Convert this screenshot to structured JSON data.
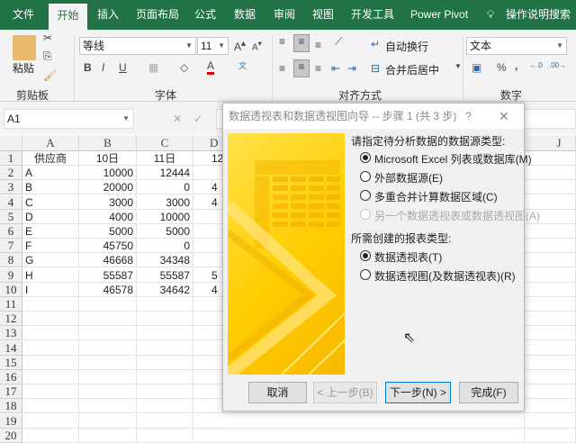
{
  "tabs": [
    "文件",
    "开始",
    "插入",
    "页面布局",
    "公式",
    "数据",
    "审阅",
    "视图",
    "开发工具",
    "Power Pivot",
    "操作说明搜索"
  ],
  "ribbon": {
    "clipboard": {
      "label": "剪贴板",
      "paste": "粘贴"
    },
    "font": {
      "label": "字体",
      "name": "等线",
      "size": "11",
      "bold": "B",
      "italic": "I",
      "underline": "U",
      "color": "#e00000"
    },
    "align": {
      "label": "对齐方式",
      "wrap": "自动换行",
      "merge": "合并后居中"
    },
    "number": {
      "label": "数字",
      "format": "文本",
      "percent": "%",
      "comma": ","
    }
  },
  "namebox": "A1",
  "columns": [
    "A",
    "B",
    "C",
    "D",
    "J"
  ],
  "rows": [
    "1",
    "2",
    "3",
    "4",
    "5",
    "6",
    "7",
    "8",
    "9",
    "10",
    "11",
    "12",
    "13",
    "14",
    "15",
    "16",
    "17",
    "18",
    "19",
    "20"
  ],
  "table": [
    [
      "供应商",
      "10日",
      "11日",
      "12"
    ],
    [
      "A",
      "10000",
      "12444",
      ""
    ],
    [
      "B",
      "20000",
      "0",
      "4"
    ],
    [
      "C",
      "3000",
      "3000",
      "4"
    ],
    [
      "D",
      "4000",
      "10000",
      ""
    ],
    [
      "E",
      "5000",
      "5000",
      ""
    ],
    [
      "F",
      "45750",
      "0",
      ""
    ],
    [
      "G",
      "46668",
      "34348",
      ""
    ],
    [
      "H",
      "55587",
      "55587",
      "5"
    ],
    [
      "I",
      "46578",
      "34642",
      "4"
    ]
  ],
  "dialog": {
    "title": "数据透视表和数据透视图向导 -- 步骤 1 (共 3 步)",
    "help": "?",
    "close": "✕",
    "source_heading": "请指定待分析数据的数据源类型:",
    "source_options": [
      "Microsoft Excel 列表或数据库(M)",
      "外部数据源(E)",
      "多重合并计算数据区域(C)",
      "另一个数据透视表或数据透视图(A)"
    ],
    "report_heading": "所需创建的报表类型:",
    "report_options": [
      "数据透视表(T)",
      "数据透视图(及数据透视表)(R)"
    ],
    "buttons": {
      "cancel": "取消",
      "back": "< 上一步(B)",
      "next": "下一步(N) >",
      "finish": "完成(F)"
    }
  }
}
